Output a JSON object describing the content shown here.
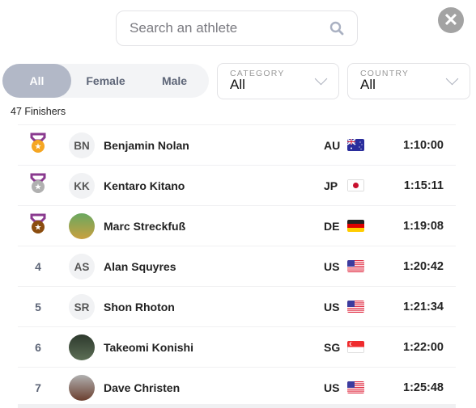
{
  "search": {
    "placeholder": "Search an athlete",
    "icon": "search-icon"
  },
  "close_icon": "close-icon",
  "gender_filter": {
    "options": [
      "All",
      "Female",
      "Male"
    ],
    "selected": "All"
  },
  "category": {
    "label": "CATEGORY",
    "value": "All"
  },
  "country": {
    "label": "COUNTRY",
    "value": "All"
  },
  "finishers_count": "47 Finishers",
  "colors": {
    "gold": "#f5a623",
    "silver": "#b0b0b0",
    "bronze": "#8b4d0f",
    "ribbon": "#8a3a8f",
    "active_tab": "#b2b8c7"
  },
  "results": [
    {
      "rank": "1",
      "medal": "gold",
      "initials": "BN",
      "name": "Benjamin Nolan",
      "country": "AU",
      "time": "1:10:00"
    },
    {
      "rank": "2",
      "medal": "silver",
      "initials": "KK",
      "name": "Kentaro Kitano",
      "country": "JP",
      "time": "1:15:11"
    },
    {
      "rank": "3",
      "medal": "bronze",
      "initials": "",
      "photo": true,
      "name": "Marc Streckfuß",
      "country": "DE",
      "time": "1:19:08"
    },
    {
      "rank": "4",
      "initials": "AS",
      "name": "Alan Squyres",
      "country": "US",
      "time": "1:20:42"
    },
    {
      "rank": "5",
      "initials": "SR",
      "name": "Shon Rhoton",
      "country": "US",
      "time": "1:21:34"
    },
    {
      "rank": "6",
      "initials": "",
      "photo": true,
      "name": "Takeomi Konishi",
      "country": "SG",
      "time": "1:22:00"
    },
    {
      "rank": "7",
      "initials": "",
      "photo": true,
      "name": "Dave Christen",
      "country": "US",
      "time": "1:25:48"
    }
  ]
}
